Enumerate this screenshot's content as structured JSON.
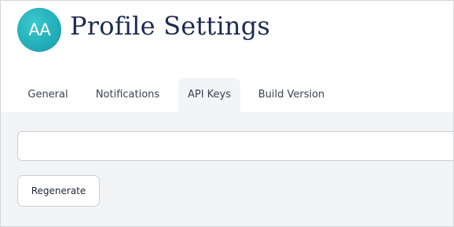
{
  "header": {
    "avatar_initials": "AA",
    "title": "Profile Settings"
  },
  "tabs": [
    {
      "label": "General",
      "active": false
    },
    {
      "label": "Notifications",
      "active": false
    },
    {
      "label": "API Keys",
      "active": true
    },
    {
      "label": "Build Version",
      "active": false
    }
  ],
  "api_keys": {
    "key_value": "",
    "regenerate_label": "Regenerate"
  },
  "colors": {
    "title": "#1d2b4f",
    "avatar": "#23b0ba",
    "content_background": "#f3f4f6"
  }
}
